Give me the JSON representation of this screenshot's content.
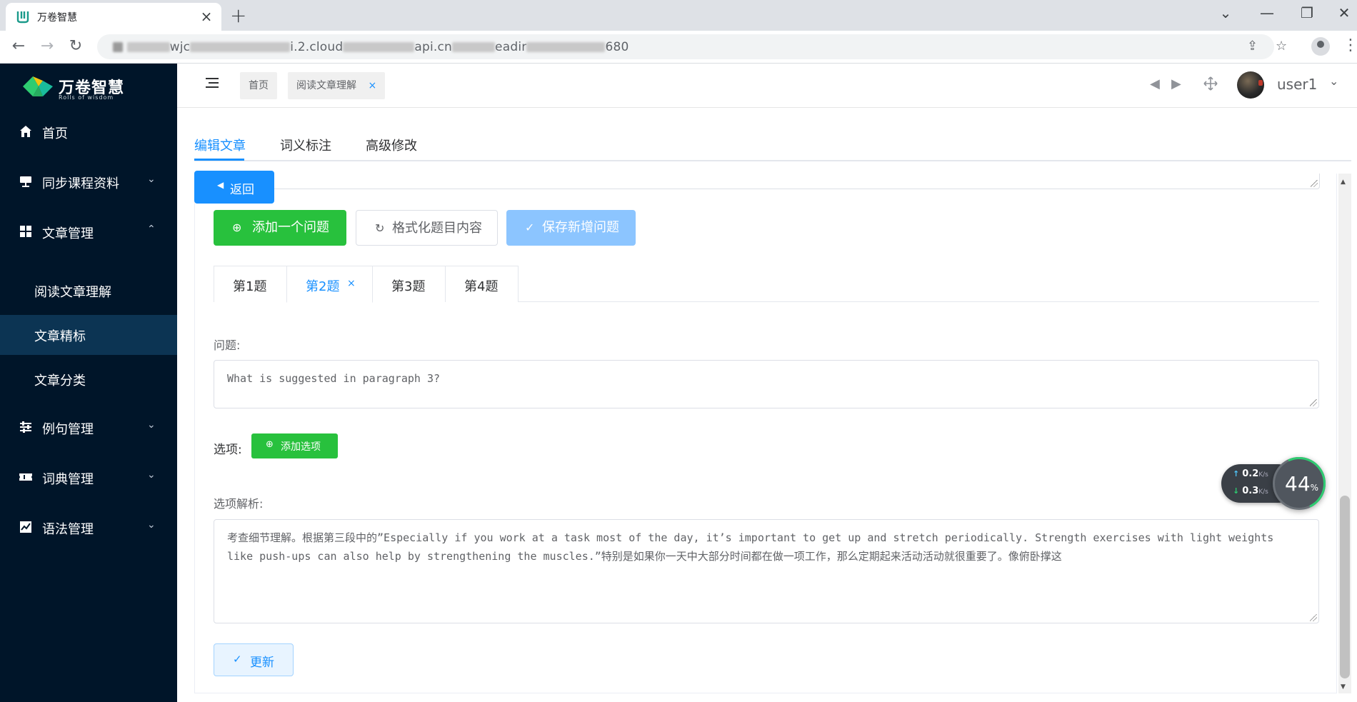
{
  "browser": {
    "tab_title": "万卷智慧",
    "tab_close": "×",
    "new_tab": "+",
    "url_fragments": [
      "wjc",
      "i.2.cloud",
      "api.cn",
      "eadir",
      "680"
    ],
    "window_controls": {
      "minimize": "—",
      "restore": "❐",
      "close": "✕",
      "tab_search": "⌄"
    }
  },
  "sidebar": {
    "logo_text": "万卷智慧",
    "logo_subtitle": "Rolls of wisdom",
    "items": [
      {
        "label": "首页",
        "icon": "home-icon"
      },
      {
        "label": "同步课程资料",
        "icon": "board-icon"
      },
      {
        "label": "文章管理",
        "icon": "grid-icon"
      },
      {
        "label": "例句管理",
        "icon": "sliders-icon"
      },
      {
        "label": "词典管理",
        "icon": "ticket-icon"
      },
      {
        "label": "语法管理",
        "icon": "chart-icon"
      }
    ],
    "subitems": [
      {
        "label": "阅读文章理解"
      },
      {
        "label": "文章精标"
      },
      {
        "label": "文章分类"
      }
    ],
    "expand_arrow": "⌄",
    "collapse_arrow": "⌃"
  },
  "header": {
    "tags": [
      {
        "label": "首页"
      },
      {
        "label": "阅读文章理解",
        "close": "×"
      }
    ],
    "username": "user1",
    "user_chevron": "⌄",
    "prev_arrow": "◀",
    "next_arrow": "▶"
  },
  "content_tabs": [
    {
      "label": "编辑文章"
    },
    {
      "label": "词义标注"
    },
    {
      "label": "高级修改"
    }
  ],
  "editor": {
    "back_label": "返回",
    "add_question_label": "添加一个问题",
    "format_label": "格式化题目内容",
    "save_label": "保存新增问题",
    "question_tabs": [
      {
        "label": "第1题"
      },
      {
        "label": "第2题",
        "close": "×"
      },
      {
        "label": "第3题"
      },
      {
        "label": "第4题"
      }
    ],
    "question_label": "问题:",
    "question_value": "What is suggested in paragraph 3?",
    "options_label": "选项:",
    "add_option_label": "添加选项",
    "analysis_label": "选项解析:",
    "analysis_value": "考查细节理解。根据第三段中的”Especially if you work at a task most of the day, it’s important to get up and stretch periodically. Strength exercises with light weights like push-ups can also help by strengthening the muscles.”特别是如果你一天中大部分时间都在做一项工作，那么定期起来活动活动就很重要了。像俯卧撑这",
    "update_label": "更新"
  },
  "network_widget": {
    "upload": "0.2",
    "download": "0.3",
    "unit": "K/s",
    "percent": "44",
    "percent_sign": "%"
  },
  "colors": {
    "sidebar_bg": "#001529",
    "sidebar_active": "#0c3453",
    "primary": "#1890ff",
    "success": "#28c13d",
    "disabled": "#8cc5ff"
  }
}
